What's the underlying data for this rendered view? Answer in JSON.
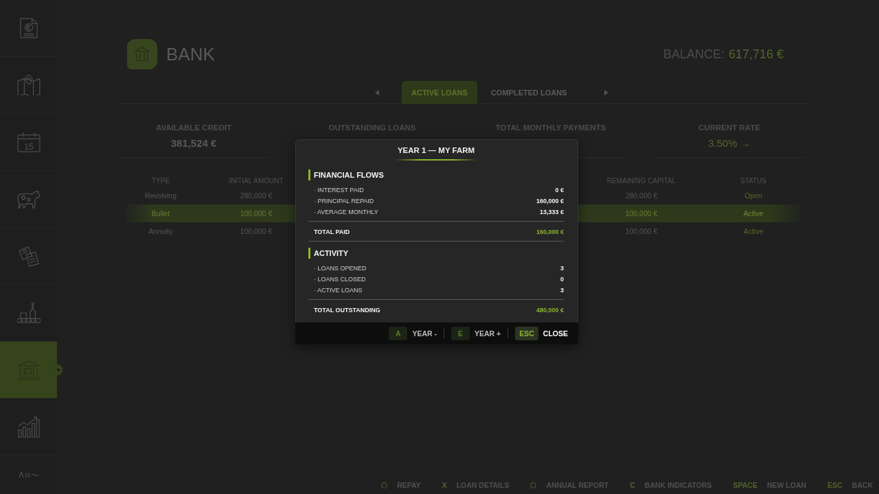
{
  "sidebar": {
    "items": [
      {
        "kind": "invoice",
        "selected": false
      },
      {
        "kind": "map",
        "selected": false
      },
      {
        "kind": "calendar",
        "label": "15",
        "selected": false
      },
      {
        "kind": "cow",
        "selected": false
      },
      {
        "kind": "documents",
        "selected": false
      },
      {
        "kind": "conveyor",
        "selected": false
      },
      {
        "kind": "bank",
        "selected": true
      },
      {
        "kind": "chart",
        "selected": false
      },
      {
        "kind": "partial",
        "selected": false
      }
    ]
  },
  "header": {
    "title": "BANK",
    "balance_label": "BALANCE:",
    "balance_value": "617,716 €"
  },
  "tabs": [
    {
      "label": "ACTIVE LOANS",
      "selected": true
    },
    {
      "label": "COMPLETED LOANS",
      "selected": false
    }
  ],
  "stats": [
    {
      "label": "AVAILABLE CREDIT",
      "value": "381,524 €",
      "highlight": false
    },
    {
      "label": "OUTSTANDING LOANS"
    },
    {
      "label": "TOTAL MONTHLY PAYMENTS"
    },
    {
      "label": "CURRENT RATE",
      "value": "3.50% →",
      "highlight": true
    }
  ],
  "table": {
    "columns": [
      "TYPE",
      "INITIAL AMOUNT",
      "REMAINING CAPITAL",
      "STATUS"
    ],
    "rows": [
      {
        "cells": [
          "Revolving",
          "280,000 €",
          "280,000 €",
          "Open"
        ],
        "selected": false
      },
      {
        "cells": [
          "Bullet",
          "100,000 €",
          "100,000 €",
          "Active"
        ],
        "selected": true
      },
      {
        "cells": [
          "Annuity",
          "100,000 €",
          "100,000 €",
          "Active"
        ],
        "selected": false
      }
    ]
  },
  "dialog": {
    "title": "YEAR 1 — MY FARM",
    "sections": [
      {
        "heading": "FINANCIAL FLOWS",
        "rows": [
          {
            "label": "· INTEREST PAID",
            "value": "0 €"
          },
          {
            "label": "· PRINCIPAL REPAID",
            "value": "160,000 €"
          },
          {
            "label": "· AVERAGE MONTHLY",
            "value": "13,333 €"
          }
        ],
        "total": {
          "label": "TOTAL PAID",
          "value": "160,000 €"
        }
      },
      {
        "heading": "ACTIVITY",
        "rows": [
          {
            "label": "· LOANS OPENED",
            "value": "3"
          },
          {
            "label": "· LOANS CLOSED",
            "value": "0"
          },
          {
            "label": "· ACTIVE LOANS",
            "value": "3"
          }
        ],
        "total": {
          "label": "TOTAL OUTSTANDING",
          "value": "480,000 €"
        }
      }
    ],
    "shortcuts": [
      {
        "key": "A",
        "label": "YEAR -",
        "emphasized": false
      },
      {
        "key": "E",
        "label": "YEAR +",
        "emphasized": false
      },
      {
        "key": "ESC",
        "label": "CLOSE",
        "emphasized": true
      }
    ]
  },
  "footer_hints": [
    {
      "kind": "glyph",
      "label": "REPAY"
    },
    {
      "kind": "key",
      "key": "X",
      "label": "LOAN DETAILS"
    },
    {
      "kind": "glyph",
      "label": "ANNUAL REPORT"
    },
    {
      "kind": "key",
      "key": "C",
      "label": "BANK INDICATORS"
    },
    {
      "kind": "key",
      "key": "SPACE",
      "label": "NEW LOAN"
    },
    {
      "kind": "key",
      "key": "ESC",
      "label": "BACK"
    }
  ]
}
